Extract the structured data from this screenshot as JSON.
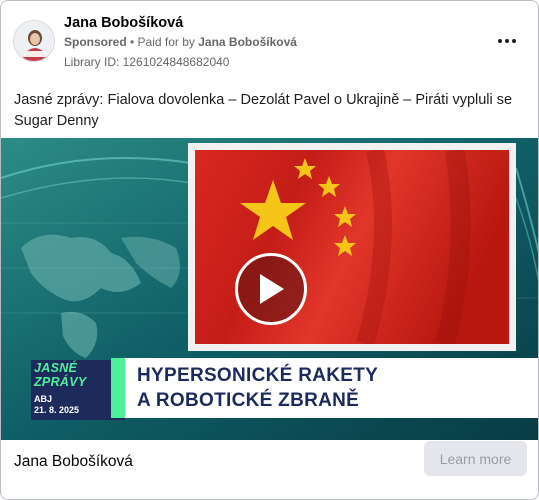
{
  "ad": {
    "advertiser_name": "Jana Bobošíková",
    "sponsored_label": "Sponsored",
    "separator": " • Paid for by ",
    "paid_for_by": "Jana Bobošíková",
    "library_id": "Library ID: 1261024848682040",
    "body_text": "Jasné zprávy: Fialova dovolenka – Dezolát Pavel o Ukrajině – Piráti vypluli se Sugar Denny"
  },
  "media": {
    "tag_line1": "JASNÉ",
    "tag_line2": "ZPRÁVY",
    "tag_sub1": "ABJ",
    "tag_sub2": "21. 8. 2025",
    "headline_line1": "HYPERSONICKÉ RAKETY",
    "headline_line2": "A ROBOTICKÉ ZBRANĚ"
  },
  "footer": {
    "name": "Jana Bobošíková",
    "cta_label": "Learn more"
  },
  "icons": {
    "more": "more-options-icon",
    "play": "play-icon",
    "avatar": "profile-avatar"
  },
  "colors": {
    "flag_red": "#d2231f",
    "flag_star": "#f5c518",
    "tag_green": "#4ff09a",
    "navy": "#1d2b5c",
    "teal_bg": "#0b4b55"
  }
}
